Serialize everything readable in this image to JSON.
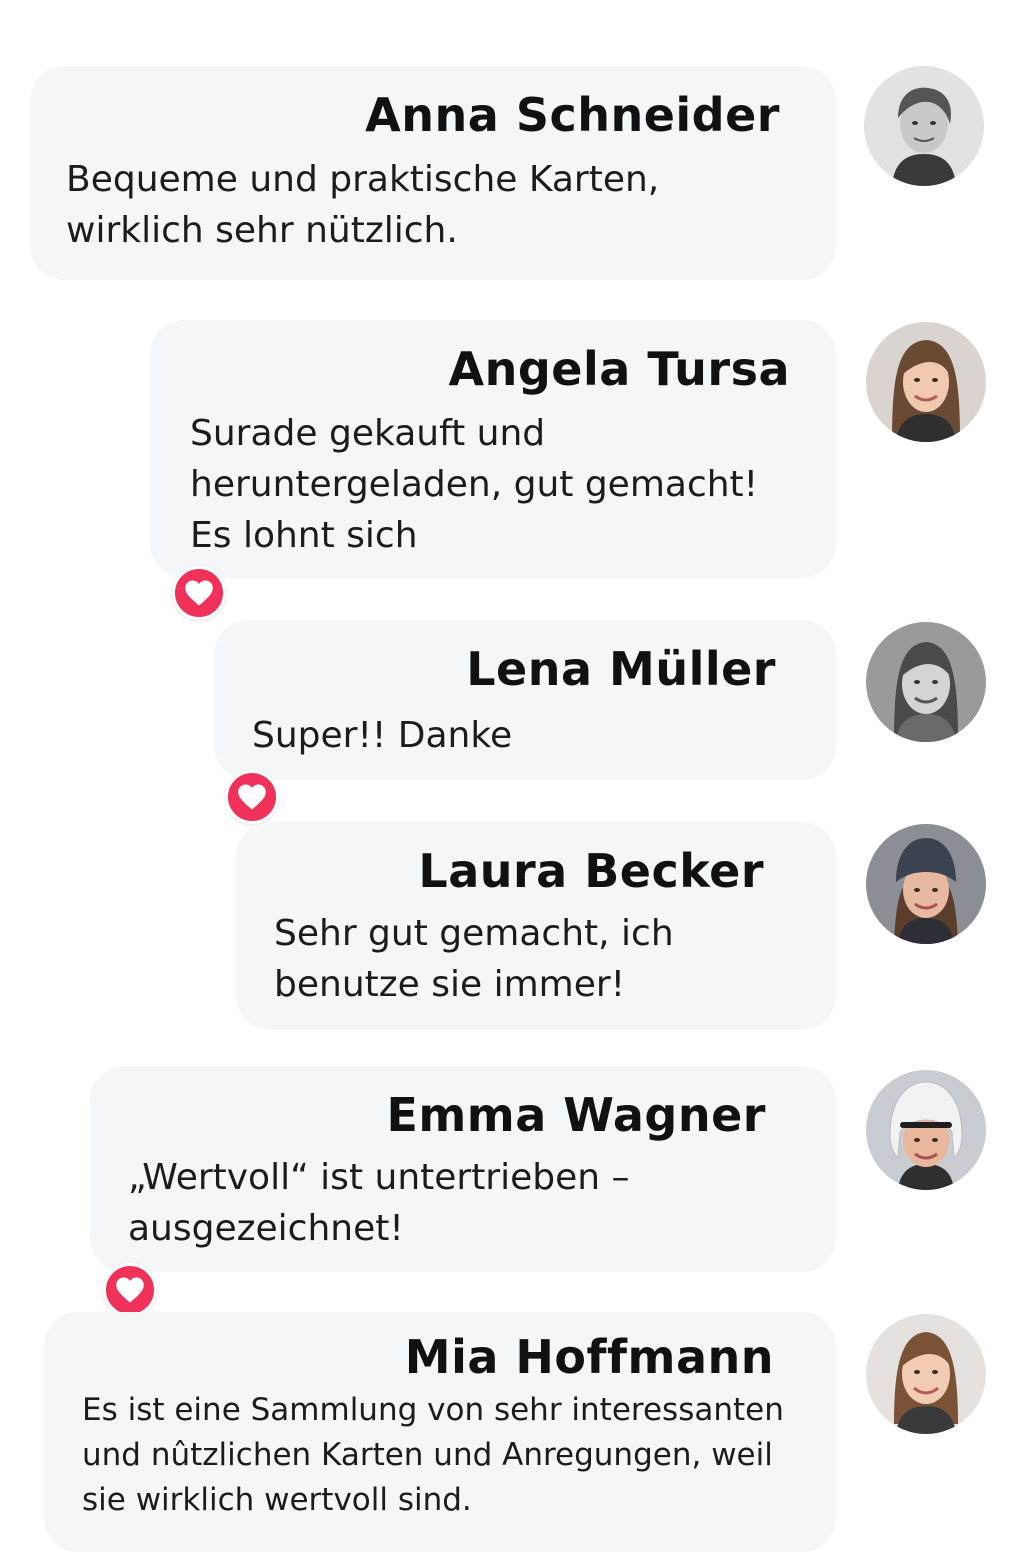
{
  "comments": [
    {
      "name": "Anna Schneider",
      "text": "Bequeme und praktische Karten,\nwirklich sehr nützlich.",
      "avatar": {
        "icon": "avatar-photo",
        "tone": "grayscale",
        "skin": "#c9c9c9",
        "hair": "#555555",
        "bg": "#e2e2e2"
      },
      "liked": false
    },
    {
      "name": "Angela Tursa",
      "text": "Surade gekauft und\nheruntergeladen, gut gemacht!\nEs lohnt sich",
      "avatar": {
        "icon": "avatar-photo",
        "tone": "color",
        "skin": "#f1c9b0",
        "hair": "#6b4a34",
        "bg": "#d9d4cf"
      },
      "liked": true
    },
    {
      "name": "Lena Müller",
      "text": "Super!! Danke",
      "avatar": {
        "icon": "avatar-photo",
        "tone": "grayscale",
        "skin": "#d4d4d4",
        "hair": "#4a4a4a",
        "bg": "#9a9a9a"
      },
      "liked": true
    },
    {
      "name": "Laura Becker",
      "text": "Sehr gut gemacht, ich\nbenutze sie immer!",
      "avatar": {
        "icon": "avatar-photo-beanie",
        "tone": "color",
        "skin": "#e6b9a0",
        "hair": "#5a3d2b",
        "bg": "#8b8f95",
        "hat": "#3b4250"
      },
      "liked": false
    },
    {
      "name": "Emma Wagner",
      "text": "„Wertvoll“ ist untertrieben –\nausgezeichnet!",
      "avatar": {
        "icon": "avatar-photo-helmet",
        "tone": "color",
        "skin": "#e8b79c",
        "hair": "#4b3326",
        "bg": "#c9ccd1",
        "hat": "#f2f2f2"
      },
      "liked": true
    },
    {
      "name": "Mia Hoffmann",
      "text": "Es ist eine Sammlung von sehr interessanten\nund nûtzlichen Karten und Anregungen, weil\nsie wirklich wertvoll sind.",
      "avatar": {
        "icon": "avatar-photo",
        "tone": "color",
        "skin": "#f2cbb3",
        "hair": "#7a5336",
        "bg": "#e4e1de"
      },
      "liked": false
    }
  ],
  "like_icon": "heart-icon",
  "colors": {
    "bubble": "#f5f6f8",
    "heart": "#f0325a",
    "text": "#1c1c1c"
  }
}
